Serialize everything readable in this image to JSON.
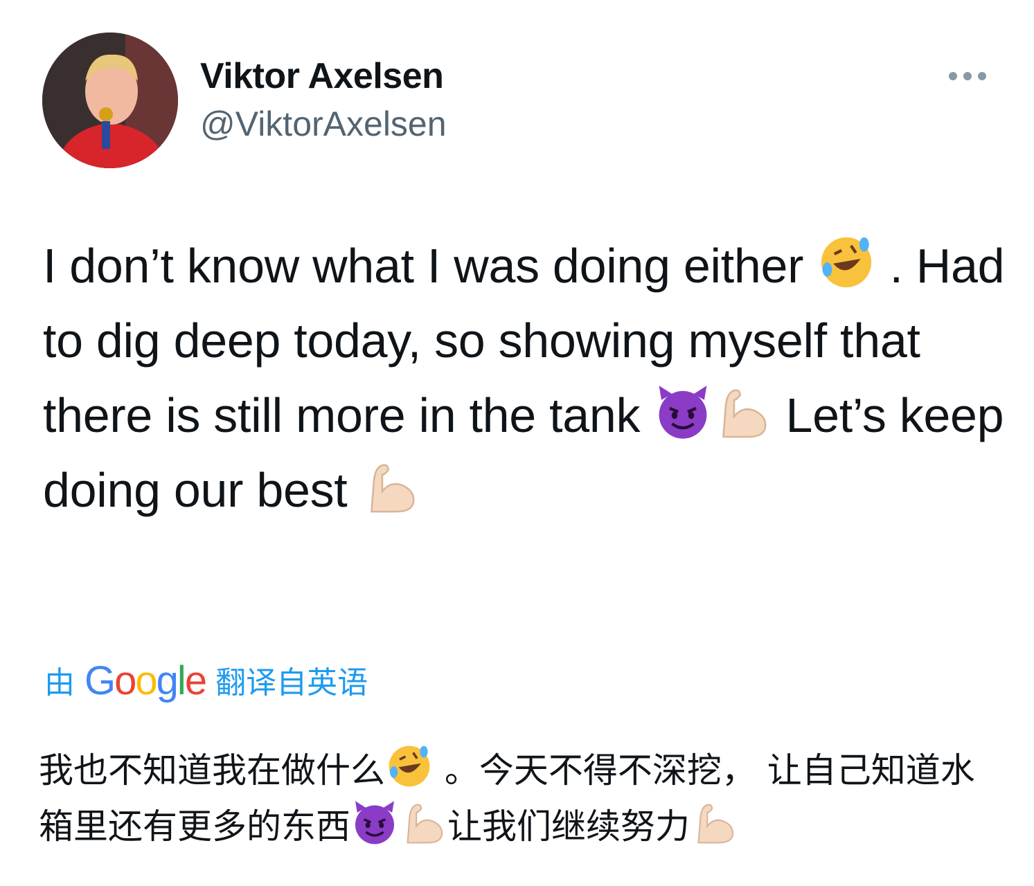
{
  "user": {
    "name": "Viktor Axelsen",
    "handle": "@ViktorAxelsen"
  },
  "icons": {
    "more": "more-options-icon",
    "rofl": "rolling-on-floor-laughing-emoji",
    "devil": "smiling-face-with-horns-emoji",
    "flex": "flexed-biceps-emoji"
  },
  "tweet": {
    "seg1": "I don’t know what I was doing either ",
    "seg2": " . Had to dig deep today, so showing myself that there is still more in the tank ",
    "seg3": " Let’s keep doing our best "
  },
  "translation": {
    "prefix": "由",
    "logo": "Google",
    "suffix": "翻译自英语",
    "seg1": "我也不知道我在做什么",
    "seg2": " 。今天不得不深挖， 让自己知道水箱里还有更多的东西",
    "seg3": "让我们继续努力"
  }
}
